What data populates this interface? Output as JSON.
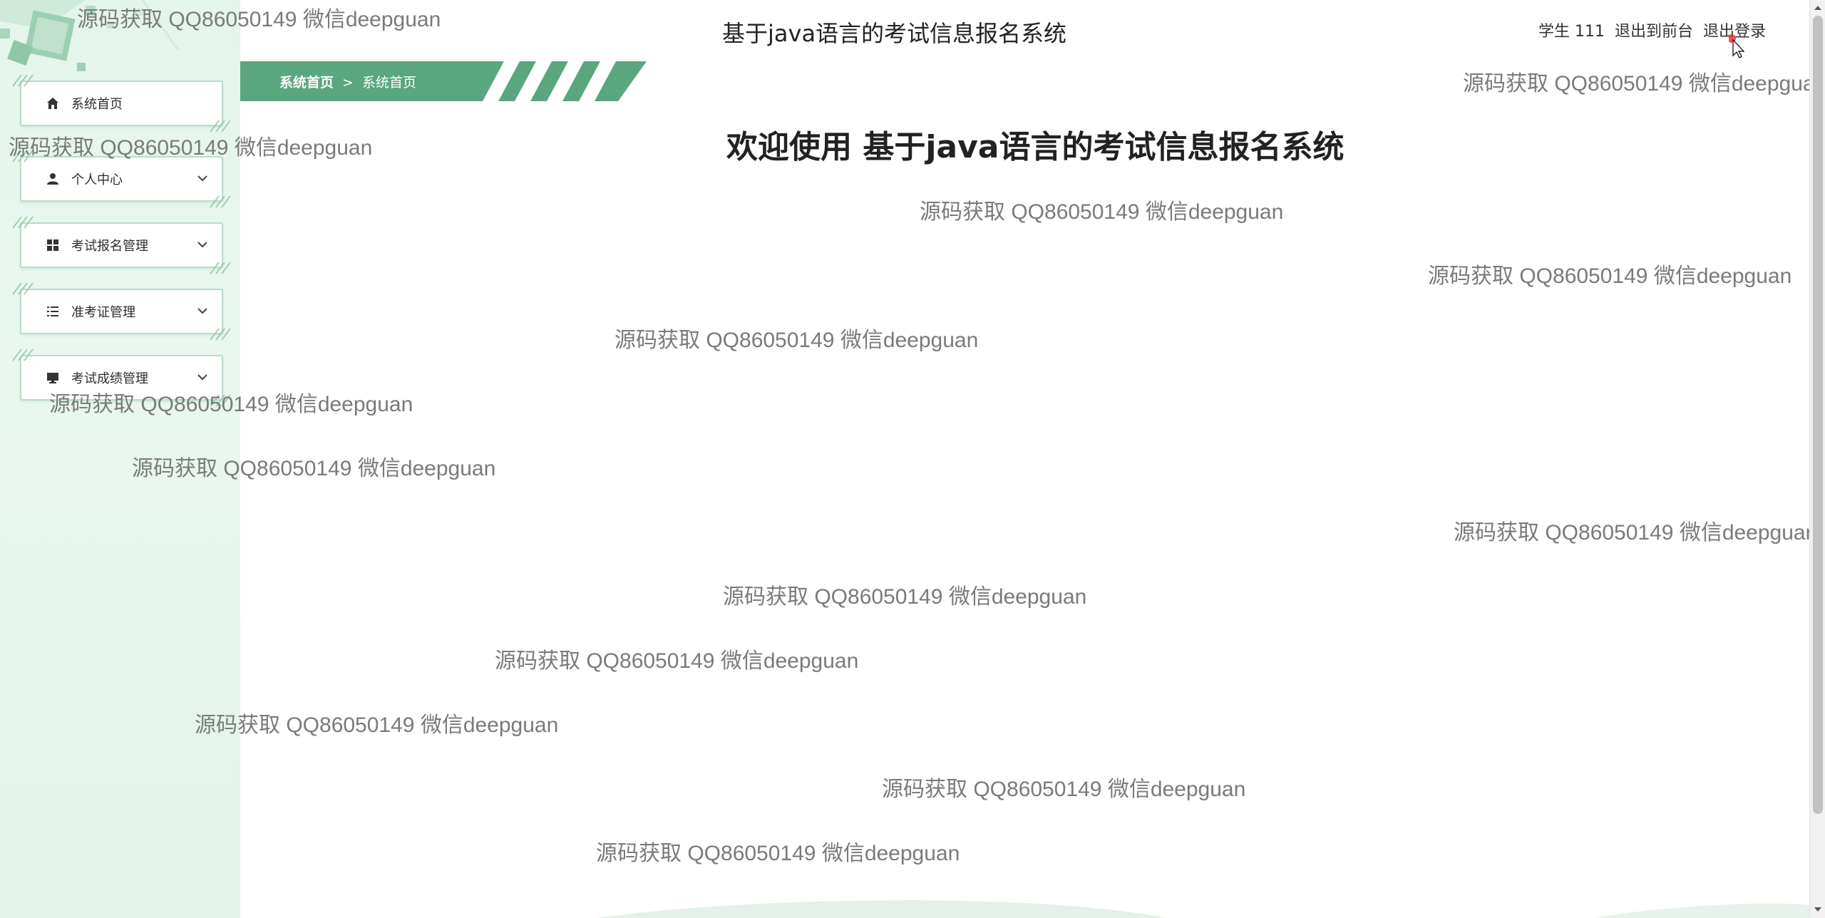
{
  "header": {
    "app_title": "基于java语言的考试信息报名系统",
    "user_label": "学生 111",
    "back_to_front": "退出到前台",
    "logout": "退出登录"
  },
  "breadcrumb": {
    "home": "系统首页",
    "separator": ">",
    "current": "系统首页"
  },
  "sidebar": {
    "items": [
      {
        "label": "系统首页",
        "icon": "home-icon",
        "expandable": false
      },
      {
        "label": "个人中心",
        "icon": "user-icon",
        "expandable": true
      },
      {
        "label": "考试报名管理",
        "icon": "grid-icon",
        "expandable": true
      },
      {
        "label": "准考证管理",
        "icon": "list-icon",
        "expandable": true
      },
      {
        "label": "考试成绩管理",
        "icon": "monitor-icon",
        "expandable": true
      }
    ]
  },
  "main": {
    "welcome": "欢迎使用 基于java语言的考试信息报名系统"
  },
  "watermark_text": [
    "源码获取 QQ86050149 微信deepguan",
    "源码获取 QQ86050149 微信deepguan",
    "源码获取 QQ86050149 微信deepguan",
    "源码获取 QQ86050149 微信deepguan",
    "源码获取 QQ86050149 微信deepguan",
    "源码获取 QQ86050149 微信deepguan",
    "源码获取 QQ86050149 微信deepguan",
    "源码获取 QQ86050149 微信deepguan",
    "源码获取 QQ86050149 微信deepguan",
    "源码获取 QQ86050149 微信deepguan",
    "源码获取 QQ86050149 微信deepguan",
    "源码获取 QQ86050149 微信deepguan",
    "源码获取 QQ86050149 微信deepguan",
    "源码获取 QQ86050149 微信deepgua"
  ],
  "colors": {
    "accent_green": "#5aa67e",
    "sidebar_bg": "#e6f6ed",
    "watermark": "#7a7a7a"
  }
}
